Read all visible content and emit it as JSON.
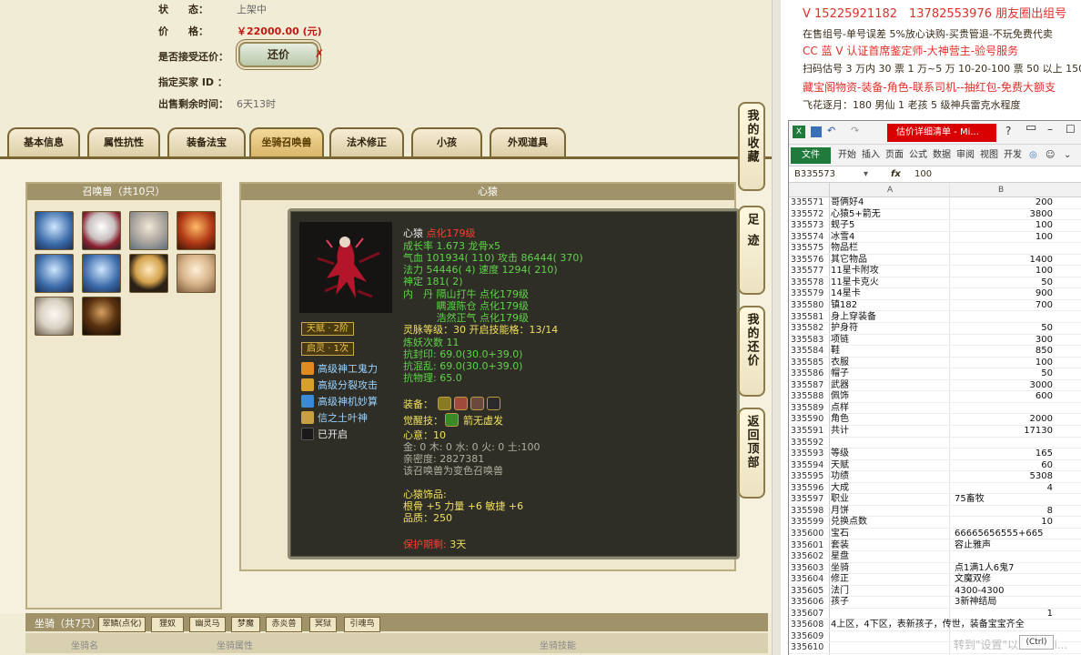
{
  "listing": {
    "status_label": "状　　态：",
    "status_value": "上架中",
    "price_label": "价　　格：",
    "price_value": "￥22000.00 (元)",
    "haggle_label": "是否接受还价：",
    "haggle_button": "还价",
    "haggle_mark": "✗",
    "buyer_label": "指定买家 ID ：",
    "time_label": "出售剩余时间：",
    "time_value": "6天13时"
  },
  "tabs": [
    "基本信息",
    "属性抗性",
    "装备法宝",
    "坐骑召唤兽",
    "法术修正",
    "小孩",
    "外观道具"
  ],
  "active_tab": "坐骑召唤兽",
  "pets": {
    "title": "召唤兽（共10只）"
  },
  "pet_detail": {
    "panel_title": "心猿",
    "name": "心猿",
    "name_level": "点化179级",
    "growth": "成长率 1.673 龙骨x5",
    "hp": "气血 101934( 110) 攻击 86444( 370)",
    "mp": "法力 54446( 4) 速度 1294( 210)",
    "shending": "神定 181( 2)",
    "neidan1": "内　丹 隔山打牛 点化179级",
    "neidan2": "　　　 瞒渡陈仓 点化179级",
    "neidan3": "　　　 浩然正气 点化179级",
    "badge1": "天赋 · 2阶",
    "badge2": "启灵 · 1次",
    "skills": [
      "高级神工鬼力",
      "高级分裂攻击",
      "高级神机妙算",
      "信之土叶神",
      "已开启"
    ],
    "lingya": "灵脉等级：30 开启技能格：13/14",
    "lianyao": "炼妖次数 11",
    "kangfeng": "抗封印: 69.0(30.0+39.0)",
    "kanghun": "抗混乱: 69.0(30.0+39.0)",
    "kangwu": "抗物理: 65.0",
    "equip_label": "装备：",
    "awaken_label": "觉醒技：",
    "awaken_value": "箭无虚发",
    "xinyi": "心意：10",
    "wuxing": "金: 0 木: 0 水: 0 火: 0 土:100",
    "qinmi": "亲密度: 2827381",
    "variant": "该召唤兽为变色召唤兽",
    "accessory_title": "心猿饰品:",
    "accessory_stats": "根骨 +5 力量 +6 敏捷 +6",
    "accessory_quality": "品质：250",
    "protect_label": "保护期剩:",
    "protect_value": "3天"
  },
  "side_buttons": [
    "我的收藏",
    "足迹",
    "我的还价",
    "返回顶部"
  ],
  "mounts": {
    "title": "坐骑（共7只）",
    "tabs": [
      "翠鳞(点化)",
      "狸奴",
      "幽灵马",
      "梦魔",
      "赤炎兽",
      "冥狱",
      "引魂鸟"
    ],
    "columns": [
      "坐骑名",
      "坐骑属性",
      "坐骑技能"
    ]
  },
  "ad": {
    "line1": "V 15225921182　13782553976 朋友圈出组号",
    "line2": "在售组号-单号误差 5%放心诀购-买贵管退-不玩免费代卖",
    "line3": "CC 蓝 V 认证首席鉴定师-大神营主-验号服务",
    "line4": "扫码估号 3 万内 30 票 1 万~5 万 10-20-100 票 50 以上 150",
    "line5": "藏宝阁物资-装备-角色-联系司机--抽红包-免费大额支",
    "line6": "飞花逐月：180 男仙 1 老孩 5 级神兵雷克水程度"
  },
  "excel": {
    "title": "估价详细清单 - Mi...",
    "ribbon": [
      "文件",
      "开始",
      "插入",
      "页面",
      "公式",
      "数据",
      "审阅",
      "视图",
      "开发"
    ],
    "name_box": "B335573",
    "fx": "fx",
    "formula": "100",
    "col_a": "A",
    "col_b": "B",
    "rows": [
      {
        "n": "335571",
        "a": "哥俩好4",
        "b": "200"
      },
      {
        "n": "335572",
        "a": "心猿5+箭无",
        "b": "3800"
      },
      {
        "n": "335573",
        "a": "蚬子5",
        "b": "100"
      },
      {
        "n": "335574",
        "a": "冰雪4",
        "b": "100"
      },
      {
        "n": "335575",
        "a": "物品栏",
        "b": ""
      },
      {
        "n": "335576",
        "a": "其它物品",
        "b": "1400"
      },
      {
        "n": "335577",
        "a": "11星卡附攻",
        "b": "100"
      },
      {
        "n": "335578",
        "a": "11星卡克火",
        "b": "50"
      },
      {
        "n": "335579",
        "a": "14星卡",
        "b": "900"
      },
      {
        "n": "335580",
        "a": "镇182",
        "b": "700"
      },
      {
        "n": "335581",
        "a": "身上穿装备",
        "b": ""
      },
      {
        "n": "335582",
        "a": "护身符",
        "b": "50"
      },
      {
        "n": "335583",
        "a": "项链",
        "b": "300"
      },
      {
        "n": "335584",
        "a": "鞋",
        "b": "850"
      },
      {
        "n": "335585",
        "a": "衣服",
        "b": "100"
      },
      {
        "n": "335586",
        "a": "帽子",
        "b": "50"
      },
      {
        "n": "335587",
        "a": "武器",
        "b": "3000"
      },
      {
        "n": "335588",
        "a": "佩饰",
        "b": "600"
      },
      {
        "n": "335589",
        "a": "点样",
        "b": ""
      },
      {
        "n": "335590",
        "a": "角色",
        "b": "2000"
      },
      {
        "n": "335591",
        "a": "共计",
        "b": "17130"
      },
      {
        "n": "335592",
        "a": "",
        "b": ""
      },
      {
        "n": "335593",
        "a": "等级",
        "b": "165"
      },
      {
        "n": "335594",
        "a": "天赋",
        "b": "60"
      },
      {
        "n": "335595",
        "a": "功绩",
        "b": "5308"
      },
      {
        "n": "335596",
        "a": "大成",
        "b": "4"
      },
      {
        "n": "335597",
        "a": "职业",
        "b2": "75畜牧"
      },
      {
        "n": "335598",
        "a": "月饼",
        "b": "8"
      },
      {
        "n": "335599",
        "a": "兑换点数",
        "b": "10"
      },
      {
        "n": "335600",
        "a": "宝石",
        "b2": "66665656555+665"
      },
      {
        "n": "335601",
        "a": "套装",
        "b2": "容止雅声"
      },
      {
        "n": "335602",
        "a": "星盘",
        "b": ""
      },
      {
        "n": "335603",
        "a": "坐骑",
        "b2": "点1满1人6鬼7"
      },
      {
        "n": "335604",
        "a": "修正",
        "b2": "文魔双修"
      },
      {
        "n": "335605",
        "a": "法门",
        "b2": "4300-4300"
      },
      {
        "n": "335606",
        "a": "孩子",
        "b2": "3新神结局"
      },
      {
        "n": "335607",
        "a": "",
        "b": "1"
      },
      {
        "n": "335608",
        "a": "4上区，4下区，表新孩子，传世，装备宝宝齐全",
        "b": ""
      },
      {
        "n": "335609",
        "a": "",
        "b": ""
      },
      {
        "n": "335610",
        "a": "",
        "b": ""
      }
    ],
    "watermark": "转到\"设置\"以激活 Wi...",
    "ctrl": "(Ctrl)"
  }
}
